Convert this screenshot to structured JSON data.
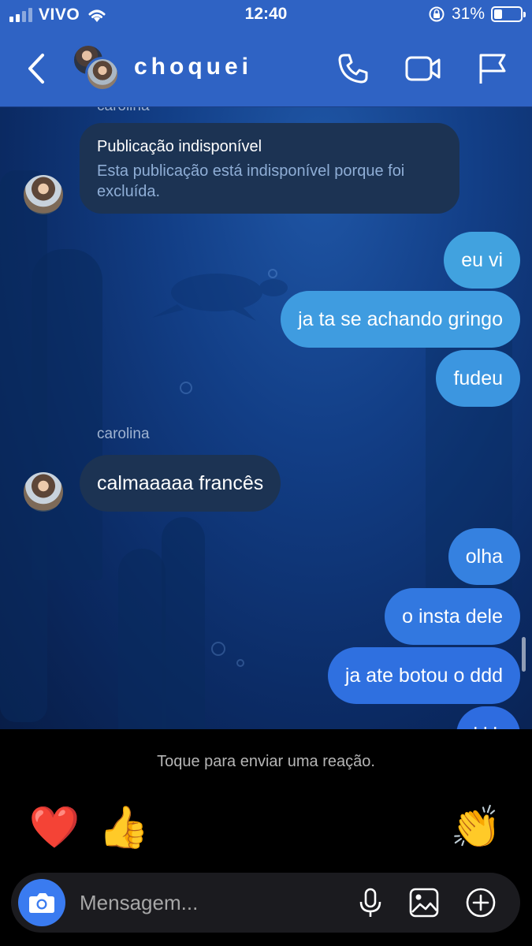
{
  "status_bar": {
    "carrier": "VIVO",
    "time": "12:40",
    "battery_text": "31%",
    "battery_level": 0.31
  },
  "header": {
    "title": "choquei",
    "back_icon": "chevron-left-icon",
    "call_icon": "phone-icon",
    "video_icon": "video-camera-icon",
    "flag_icon": "flag-icon"
  },
  "chat": {
    "top_sender_partial": "carolina",
    "unavailable_post": {
      "title": "Publicação indisponível",
      "description": "Esta publicação está indisponível porque foi excluída."
    },
    "messages": [
      {
        "side": "out",
        "text": "eu vi"
      },
      {
        "side": "out",
        "text": "ja ta se achando gringo"
      },
      {
        "side": "out",
        "text": "fudeu"
      },
      {
        "side": "sender",
        "text": "carolina"
      },
      {
        "side": "in",
        "text": "calmaaaaa francês"
      },
      {
        "side": "out",
        "text": "olha"
      },
      {
        "side": "out",
        "text": "o insta dele"
      },
      {
        "side": "out",
        "text": "ja ate botou o ddd"
      },
      {
        "side": "out",
        "text": "kkk"
      }
    ],
    "bubble_colors": {
      "incoming": "#1c3353",
      "out_top": "#3f9fe0",
      "out_bottom": "#2f6fe0"
    }
  },
  "reaction_bar": {
    "hint": "Toque para enviar uma reação.",
    "reactions": [
      "❤️",
      "👍",
      "😢",
      "😍",
      "😮",
      "😂",
      "👏"
    ]
  },
  "composer": {
    "placeholder": "Mensagem...",
    "camera_icon": "camera-icon",
    "mic_icon": "microphone-icon",
    "gallery_icon": "image-icon",
    "add_icon": "plus-circle-icon"
  },
  "colors": {
    "header_bg": "#2f63c4",
    "camera_button": "#3a7bf0"
  }
}
